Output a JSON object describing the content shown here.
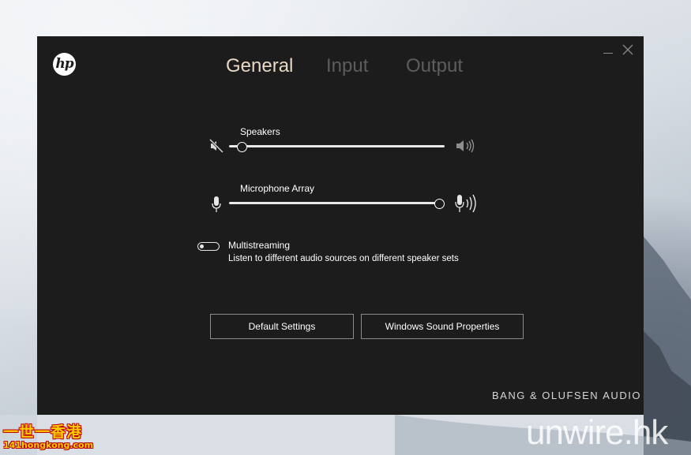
{
  "window": {
    "tabs": [
      {
        "label": "General",
        "active": true
      },
      {
        "label": "Input",
        "active": false
      },
      {
        "label": "Output",
        "active": false
      }
    ],
    "minimize_label": "_",
    "close_label": "✕"
  },
  "sliders": {
    "speakers": {
      "label": "Speakers",
      "level": 0.06,
      "icon_left": "speaker-muted-icon",
      "icon_right": "speaker-loud-icon"
    },
    "microphone": {
      "label": "Microphone Array",
      "level": 1.0,
      "icon_left": "microphone-icon",
      "icon_right": "microphone-loud-icon"
    }
  },
  "multistreaming": {
    "title": "Multistreaming",
    "description": "Listen to different audio sources on different speaker sets",
    "enabled": false
  },
  "buttons": {
    "default_settings": "Default Settings",
    "windows_sound_properties": "Windows Sound Properties"
  },
  "brand": {
    "name": "BANG & OLUFSEN",
    "suffix": "AUDIO",
    "logo_text": "hp"
  },
  "watermarks": {
    "left_top": "一世一香港",
    "left_bottom": "141hongkong.com",
    "right": "unwire.hk"
  },
  "colors": {
    "window_bg": "#1c1c1c",
    "active_tab": "#e8d8c5",
    "inactive_tab": "#5d5d5d"
  }
}
